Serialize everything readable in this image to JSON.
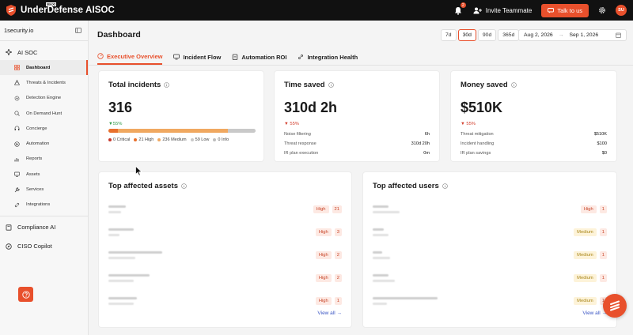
{
  "app": {
    "title": "UnderDefense AISOC",
    "badge": "MAXI"
  },
  "topbar": {
    "notifications_count": "2",
    "invite_label": "Invite Teammate",
    "talk_label": "Talk to us",
    "avatar_initials": "SU"
  },
  "sidebar": {
    "org": "1security.io",
    "group_ai_soc": "AI SOC",
    "items": [
      {
        "label": "Dashboard",
        "icon": "grid-icon"
      },
      {
        "label": "Threats & Incidents",
        "icon": "alert-icon"
      },
      {
        "label": "Detection Engine",
        "icon": "gear-icon"
      },
      {
        "label": "On Demand Hunt",
        "icon": "search-icon"
      },
      {
        "label": "Concierge",
        "icon": "headset-icon"
      },
      {
        "label": "Automation",
        "icon": "automation-icon"
      },
      {
        "label": "Reports",
        "icon": "chart-icon"
      },
      {
        "label": "Assets",
        "icon": "assets-icon"
      },
      {
        "label": "Services",
        "icon": "wrench-icon"
      },
      {
        "label": "Integrations",
        "icon": "link-icon"
      }
    ],
    "compliance": "Compliance AI",
    "ciso": "CISO Copilot"
  },
  "header": {
    "title": "Dashboard",
    "ranges": [
      "7d",
      "30d",
      "90d",
      "365d"
    ],
    "active_range": "30d",
    "date_from": "Aug 2, 2026",
    "date_to": "Sep 1, 2026"
  },
  "tabs": [
    {
      "label": "Executive Overview"
    },
    {
      "label": "Incident Flow"
    },
    {
      "label": "Automation ROI"
    },
    {
      "label": "Integration Health"
    }
  ],
  "total_incidents": {
    "title": "Total incidents",
    "value": "316",
    "delta": "55%",
    "breakdown": [
      {
        "label": "0 Critical",
        "count": 0,
        "color": "#c8392b"
      },
      {
        "label": "21 High",
        "count": 21,
        "color": "#e8702c"
      },
      {
        "label": "236 Medium",
        "count": 236,
        "color": "#f0a860"
      },
      {
        "label": "59 Low",
        "count": 59,
        "color": "#c9c9c9"
      },
      {
        "label": "0 Info",
        "count": 0,
        "color": "#bdbdbd"
      }
    ]
  },
  "time_saved": {
    "title": "Time saved",
    "value": "310d 2h",
    "delta": "55%",
    "rows": [
      {
        "label": "Noise filtering",
        "value": "6h"
      },
      {
        "label": "Threat response",
        "value": "310d 20h"
      },
      {
        "label": "IR plan execution",
        "value": "0m"
      }
    ]
  },
  "money_saved": {
    "title": "Money saved",
    "value": "$510K",
    "delta": "55%",
    "rows": [
      {
        "label": "Threat mitigation",
        "value": "$510K"
      },
      {
        "label": "Incident handling",
        "value": "$100"
      },
      {
        "label": "IR plan savings",
        "value": "$0"
      }
    ]
  },
  "top_assets": {
    "title": "Top affected assets",
    "view_all": "View all →",
    "rows": [
      {
        "severity": "High",
        "count": "21"
      },
      {
        "severity": "High",
        "count": "3"
      },
      {
        "severity": "High",
        "count": "2"
      },
      {
        "severity": "High",
        "count": "2"
      },
      {
        "severity": "High",
        "count": "1"
      }
    ]
  },
  "top_users": {
    "title": "Top affected users",
    "view_all": "View all →",
    "rows": [
      {
        "severity": "High",
        "count": "1"
      },
      {
        "severity": "Medium",
        "count": "1"
      },
      {
        "severity": "Medium",
        "count": "1"
      },
      {
        "severity": "Medium",
        "count": "1"
      },
      {
        "severity": "Medium",
        "count": "1"
      }
    ]
  },
  "colors": {
    "accent": "#e8502c",
    "link": "#3c57c4",
    "up": "#2f9a48",
    "down": "#d23c2a"
  }
}
